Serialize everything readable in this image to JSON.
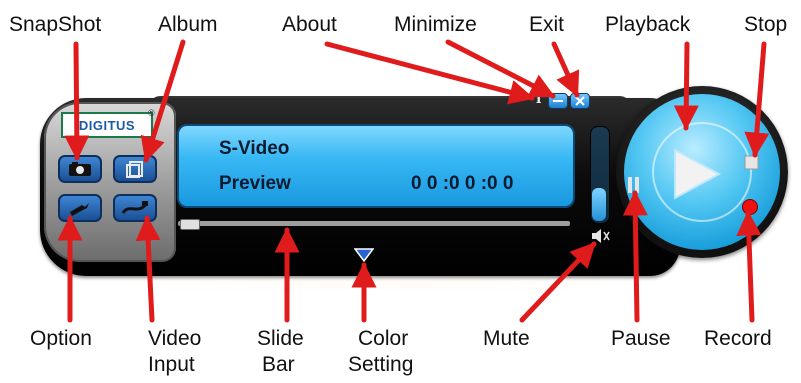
{
  "labels": {
    "snapshot": "SnapShot",
    "album": "Album",
    "about": "About",
    "minimize": "Minimize",
    "exit": "Exit",
    "playback": "Playback",
    "stop": "Stop",
    "option": "Option",
    "video_input_1": "Video",
    "video_input_2": "Input",
    "slide_bar_1": "Slide",
    "slide_bar_2": "Bar",
    "color_setting_1": "Color",
    "color_setting_2": "Setting",
    "mute": "Mute",
    "pause": "Pause",
    "record": "Record"
  },
  "player": {
    "logo_text": "DIGITUS",
    "logo_mark": "®",
    "screen": {
      "source": "S-Video",
      "mode": "Preview",
      "timecode": "0 0 :0 0 :0 0"
    },
    "slide_bar_position": 0.0,
    "volume_level": 0.35
  },
  "icons": {
    "snapshot": "camera-icon",
    "album": "album-icon",
    "option": "wrench-icon",
    "video_input": "cable-icon",
    "about": "info-icon",
    "minimize": "minimize-icon",
    "exit": "close-icon",
    "playback": "play-icon",
    "stop": "stop-icon",
    "pause": "pause-icon",
    "record": "record-icon",
    "mute": "speaker-icon",
    "color_setting": "triangle-down-icon"
  },
  "colors": {
    "screen_blue": "#38b8f3",
    "dial_blue": "#1aa0dc",
    "arrow_red": "#e01b1b",
    "record_red": "#ee1111",
    "button_blue": "#1a4f95"
  }
}
